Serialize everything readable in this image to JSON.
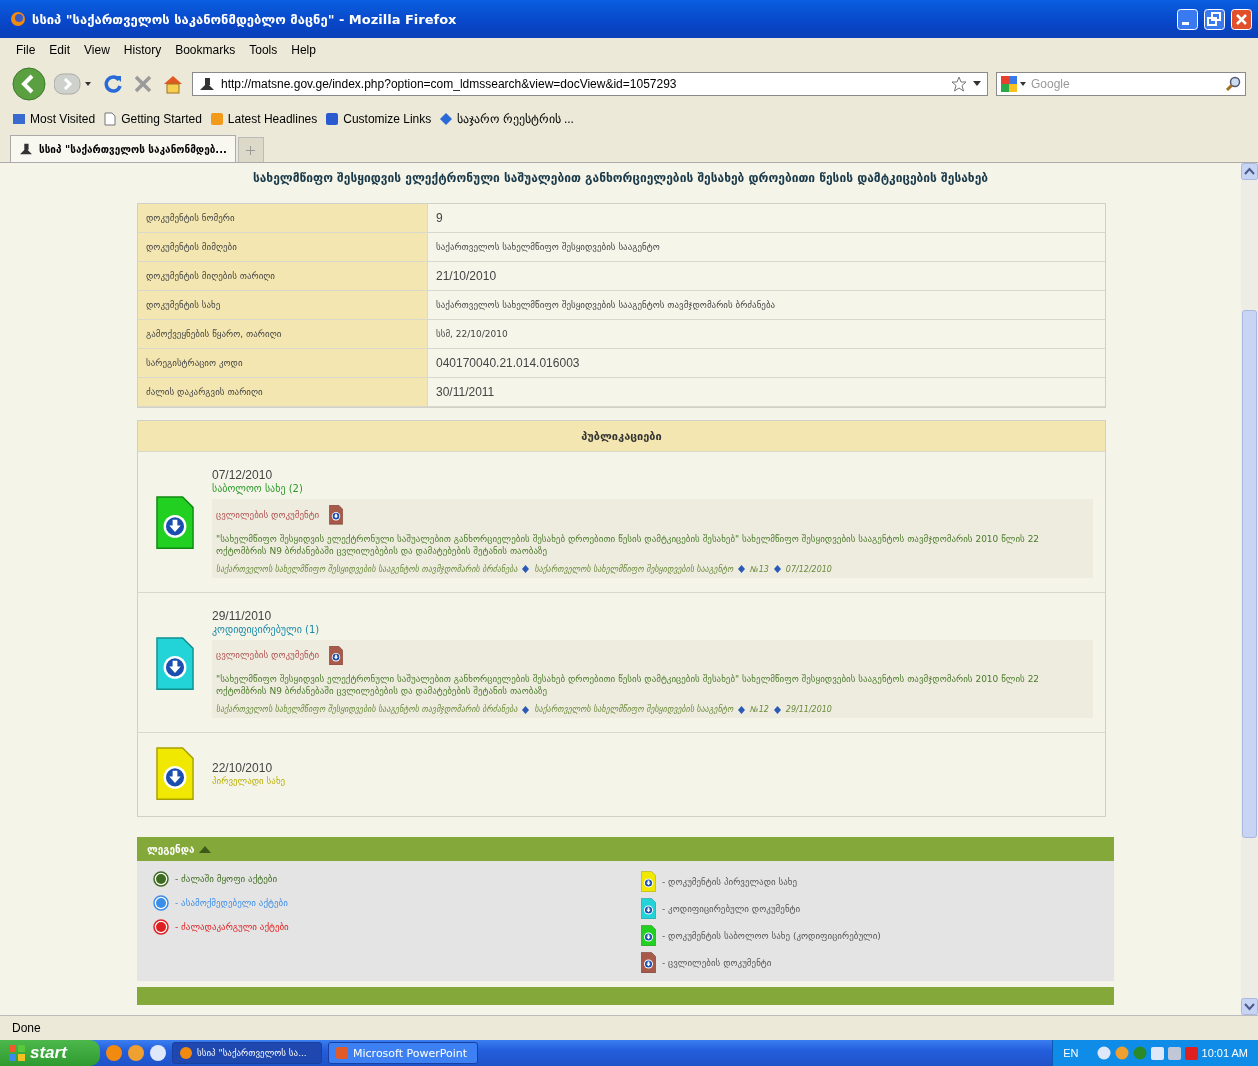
{
  "window": {
    "title": "სსიპ \"საქართველოს საკანონმდებლო მაცნე\" - Mozilla Firefox"
  },
  "menu": [
    "File",
    "Edit",
    "View",
    "History",
    "Bookmarks",
    "Tools",
    "Help"
  ],
  "navigation": {
    "url": "http://matsne.gov.ge/index.php?option=com_ldmssearch&view=docView&id=1057293",
    "search": {
      "placeholder": "Google"
    }
  },
  "bookmarks": [
    {
      "label": "Most Visited",
      "kind": "folder"
    },
    {
      "label": "Getting Started",
      "kind": "page"
    },
    {
      "label": "Latest Headlines",
      "kind": "feed"
    },
    {
      "label": "Customize Links",
      "kind": "link"
    },
    {
      "label": "საჯარო რეესტრის ...",
      "kind": "site"
    }
  ],
  "tabs": [
    {
      "label": "სსიპ \"საქართველოს საკანონმდებ...",
      "selected": true
    }
  ],
  "document": {
    "title": "სახელმწიფო შესყიდვის ელექტრონული საშუალებით განხორციელების შესახებ დროებითი წესის დამტკიცების შესახებ",
    "fields": [
      {
        "label": "დოკუმენტის ნომერი",
        "value": "9"
      },
      {
        "label": "დოკუმენტის მიმღები",
        "value": "საქართველოს სახელმწიფო შესყიდვების სააგენტო"
      },
      {
        "label": "დოკუმენტის მიღების თარიღი",
        "value": "21/10/2010"
      },
      {
        "label": "დოკუმენტის სახე",
        "value": "საქართველოს სახელმწიფო შესყიდვების სააგენტოს თავმჯდომარის ბრძანება"
      },
      {
        "label": "გამოქვეყნების წყარო, თარიღი",
        "value": "სსმ, 22/10/2010"
      },
      {
        "label": "სარეგისტრაციო კოდი",
        "value": "040170040.21.014.016003"
      },
      {
        "label": "ძალის დაკარგვის თარიღი",
        "value": "30/11/2011"
      }
    ],
    "publications": {
      "title": "პუბლიკაციები",
      "items": [
        {
          "kind": "final",
          "date": "07/12/2010",
          "status": "საბოლოო სახე (2)",
          "change": {
            "label": "ცვლილების დოკუმენტი",
            "description": "\"სახელმწიფო შესყიდვის ელექტრონული საშუალებით განხორციელების შესახებ დროებითი წესის დამტკიცების შესახებ\" სახელმწიფო შესყიდვების სააგენტოს თავმჯდომარის 2010 წლის 22 ოქტომბრის N9 ბრძანებაში ცვლილებების და დამატებების შეტანის თაობაზე",
            "meta": [
              "საქართველოს სახელმწიფო შესყიდვების სააგენტოს თავმჯდომარის ბრძანება",
              "საქართველოს სახელმწიფო შესყიდვების სააგენტო",
              "№13",
              "07/12/2010"
            ]
          }
        },
        {
          "kind": "codified",
          "date": "29/11/2010",
          "status": "კოდიფიცირებული (1)",
          "change": {
            "label": "ცვლილების დოკუმენტი",
            "description": "\"სახელმწიფო შესყიდვის ელექტრონული საშუალებით განხორციელების შესახებ დროებითი წესის დამტკიცების შესახებ\" სახელმწიფო შესყიდვების სააგენტოს თავმჯდომარის 2010 წლის 22 ოქტომბრის N9 ბრძანებაში ცვლილებების და დამატებების შეტანის თაობაზე",
            "meta": [
              "საქართველოს სახელმწიფო შესყიდვების სააგენტოს თავმჯდომარის ბრძანება",
              "საქართველოს სახელმწიფო შესყიდვების სააგენტო",
              "№12",
              "29/11/2010"
            ]
          }
        },
        {
          "kind": "original",
          "date": "22/10/2010",
          "status": "პირველადი სახე"
        }
      ]
    },
    "legend": {
      "title": "ლეგენდა",
      "expanded": true,
      "acts": [
        {
          "label": "- ძალაში მყოფი აქტები",
          "color": "#3d6b1f"
        },
        {
          "label": "- ასამოქმედებელი აქტები",
          "color": "#3a8de8"
        },
        {
          "label": "- ძალადაკარგული აქტები",
          "color": "#e02020"
        }
      ],
      "documents": [
        {
          "kind": "original",
          "label": "- დოკუმენტის პირველადი სახე"
        },
        {
          "kind": "codified",
          "label": "- კოდიფიცირებული დოკუმენტი"
        },
        {
          "kind": "final",
          "label": "- დოკუმენტის საბოლოო სახე (კოდიფიცირებული)"
        },
        {
          "kind": "change",
          "label": "- ცვლილების დოკუმენტი"
        }
      ]
    }
  },
  "status_bar": "Done",
  "taskbar": {
    "start": "start",
    "items": [
      {
        "label": "სსიპ \"საქართველოს სა...",
        "selected": true,
        "kind": "firefox"
      },
      {
        "label": "Microsoft PowerPoint",
        "selected": false,
        "kind": "powerpoint"
      }
    ],
    "language": "EN",
    "clock": "10:01 AM"
  }
}
